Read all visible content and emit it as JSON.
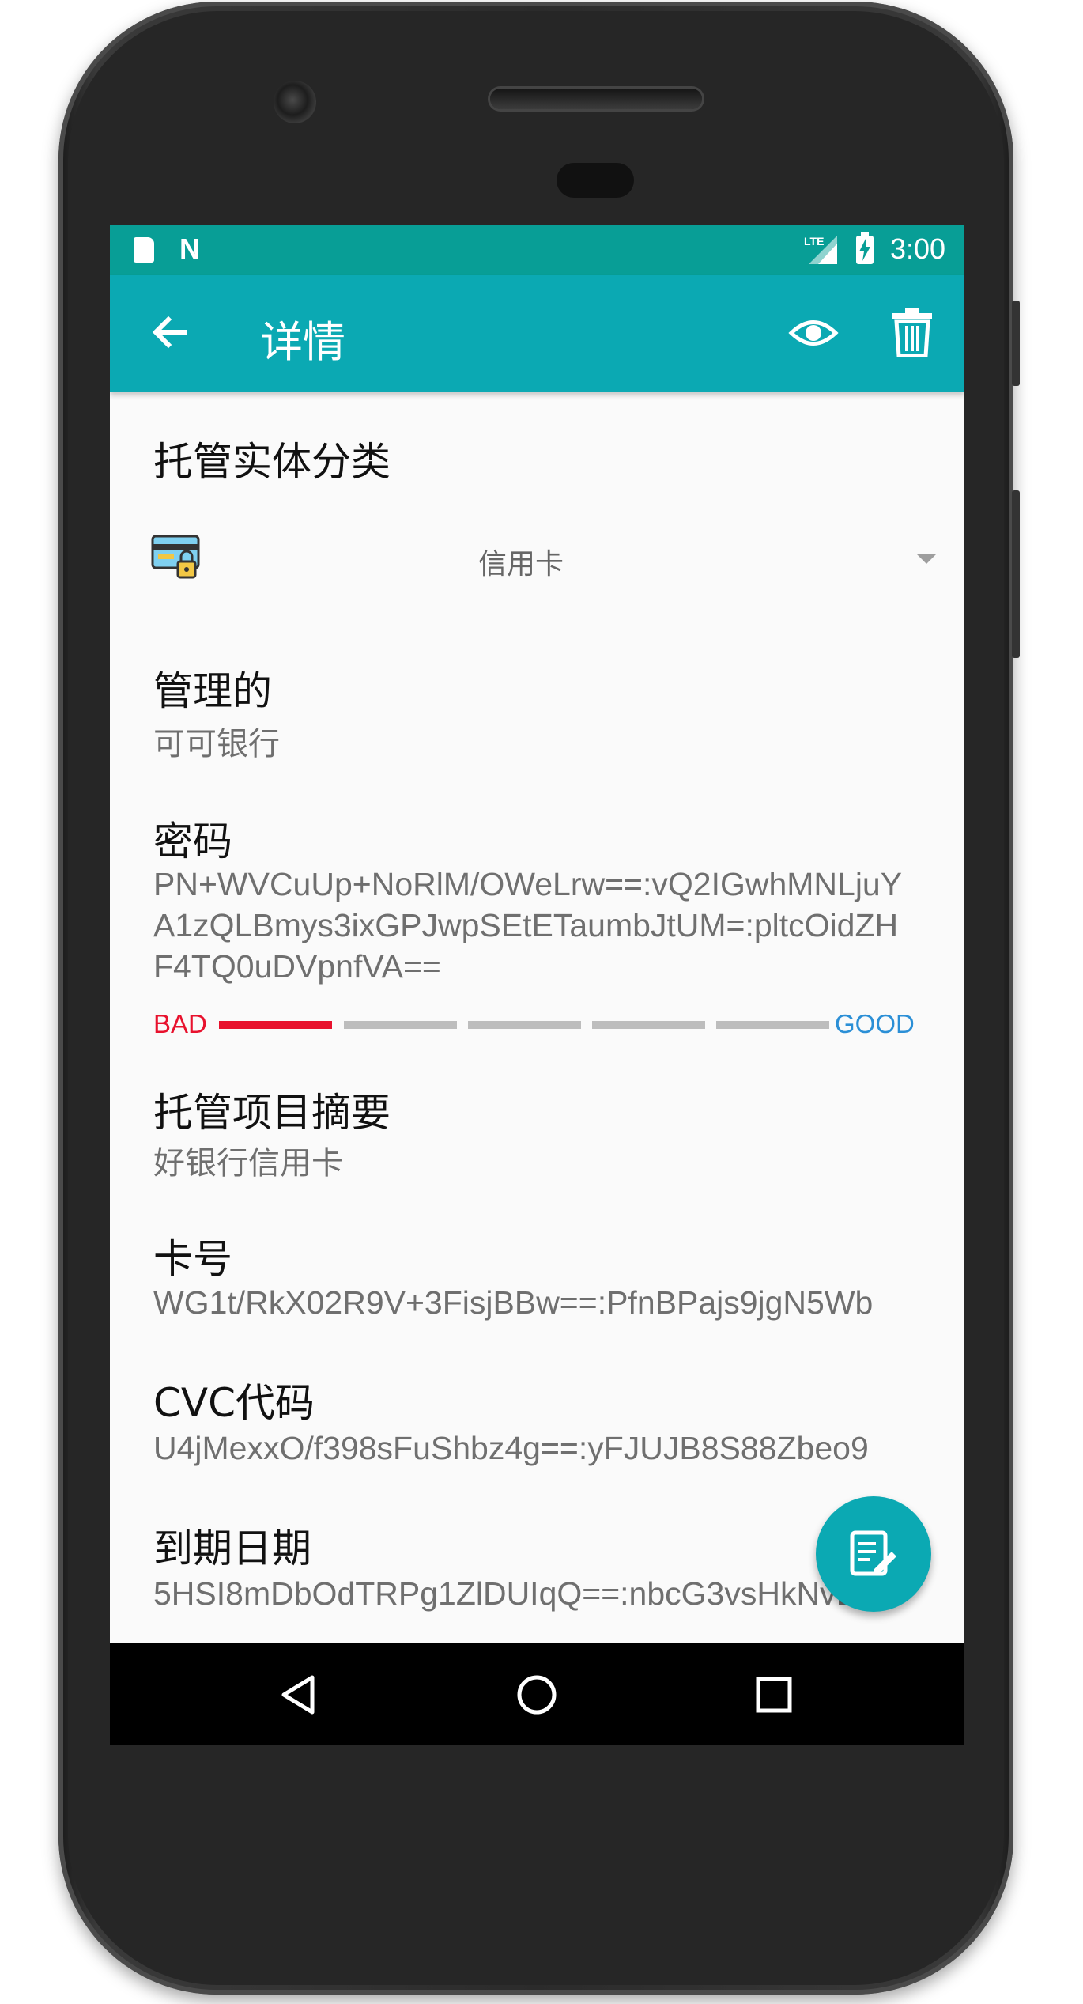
{
  "status_bar": {
    "time": "3:00",
    "network": "LTE"
  },
  "app_bar": {
    "title": "详情"
  },
  "category": {
    "label": "托管实体分类",
    "selected": "信用卡"
  },
  "fields": {
    "managed_by_label": "管理的",
    "managed_by_value": "可可银行",
    "password_label": "密码",
    "password_value": "PN+WVCuUp+NoRlM/OWeLrw==:vQ2IGwhMNLjuYA1zQLBmys3ixGPJwpSEtETaumbJtUM=:pltcOidZHF4TQ0uDVpnfVA==",
    "summary_label": "托管项目摘要",
    "summary_value": "好银行信用卡",
    "card_number_label": "卡号",
    "card_number_value": "WG1t/RkX02R9V+3FisjBBw==:PfnBPajs9jgN5Wb",
    "cvc_label": "CVC代码",
    "cvc_value": "U4jMexxO/f398sFuShbz4g==:yFJUJB8S88Zbeo9",
    "expiry_label": "到期日期",
    "expiry_value": "5HSI8mDbOdTRPg1ZlDUIqQ==:nbcG3vsHkNvBrl"
  },
  "password_strength": {
    "bad_label": "BAD",
    "good_label": "GOOD",
    "level": 1,
    "max": 5
  },
  "colors": {
    "status_bar": "#089e96",
    "app_bar": "#0ba9b3",
    "strength_bad": "#e8112d",
    "strength_good": "#2b8fd6"
  },
  "icons": {
    "back": "arrow-left-icon",
    "view": "eye-icon",
    "delete": "trash-icon",
    "category": "credit-card-lock-icon",
    "fab": "edit-note-icon",
    "nav_back": "triangle-back-icon",
    "nav_home": "circle-home-icon",
    "nav_recents": "square-recents-icon"
  }
}
